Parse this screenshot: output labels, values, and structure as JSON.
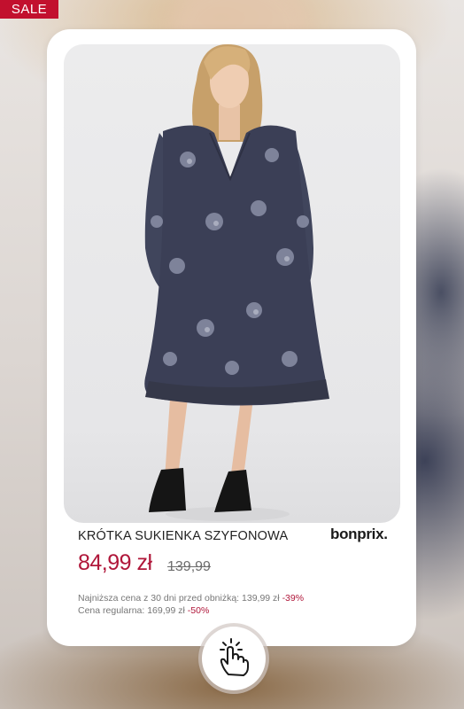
{
  "badge": {
    "sale_label": "SALE"
  },
  "product": {
    "title": "KRÓTKA SUKIENKA SZYFONOWA",
    "brand": "bonprix.",
    "price": "84,99 zł",
    "old_price": "139,99",
    "lowest_price_label": "Najniższa cena z 30 dni przed obniżką: 139,99 zł",
    "lowest_price_discount": "-39%",
    "regular_price_label": "Cena regularna: 169,99 zł",
    "regular_price_discount": "-50%"
  },
  "icons": {
    "tap": "hand-tap-icon"
  },
  "colors": {
    "accent": "#b0173a",
    "badge": "#c2102e",
    "dress": "#3b3f56"
  }
}
